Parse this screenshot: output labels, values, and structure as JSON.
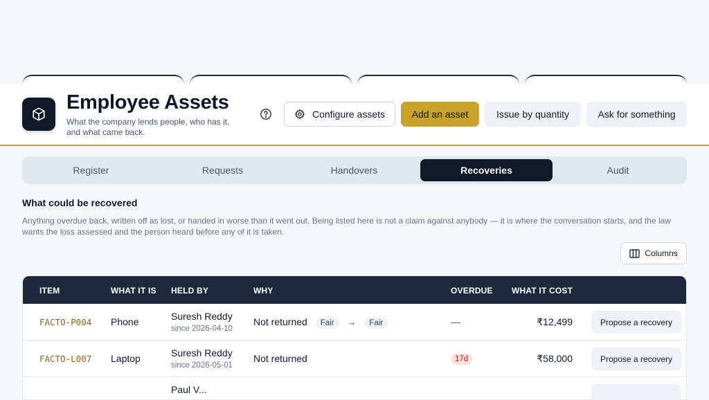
{
  "header": {
    "title": "Employee Assets",
    "subtitle": "What the company lends people, who has it, and what came back.",
    "buttons": {
      "configure": "Configure assets",
      "add": "Add an asset",
      "issue": "Issue by quantity",
      "ask": "Ask for something"
    }
  },
  "tabs": [
    {
      "label": "Register"
    },
    {
      "label": "Requests"
    },
    {
      "label": "Handovers"
    },
    {
      "label": "Recoveries",
      "active": true
    },
    {
      "label": "Audit"
    }
  ],
  "section": {
    "title": "What could be recovered",
    "description": "Anything overdue back, written off as lost, or handed in worse than it went out. Being listed here is not a claim against anybody — it is where the conversation starts, and the law wants the loss assessed and the person heard before any of it is taken."
  },
  "columns_button": "Columns",
  "table": {
    "headers": {
      "item": "ITEM",
      "what": "WHAT IT IS",
      "held": "HELD BY",
      "why": "WHY",
      "overdue": "OVERDUE",
      "cost": "WHAT IT COST"
    },
    "rows": [
      {
        "item": "FACTO-P004",
        "what": "Phone",
        "held_by": "Suresh Reddy",
        "since": "since 2026-04-10",
        "why": "Not returned",
        "condition_from": "Fair",
        "arrow": "→",
        "condition_to": "Fair",
        "overdue": "—",
        "cost": "₹12,499",
        "action": "Propose a recovery"
      },
      {
        "item": "FACTO-L007",
        "what": "Laptop",
        "held_by": "Suresh Reddy",
        "since": "since 2026-05-01",
        "why": "Not returned",
        "overdue": "17d",
        "cost": "₹58,000",
        "action": "Propose a recovery"
      },
      {
        "held_by": "Paul V..."
      }
    ]
  },
  "colors": {
    "accent": "#c9a227",
    "dark": "#111827",
    "table_header": "#1e293b",
    "overdue_bg": "#fde2e2",
    "overdue_text": "#b42318"
  },
  "icons": {
    "logo": "cube-icon",
    "help": "question-circle-icon",
    "configure": "gear-icon",
    "columns": "columns-icon"
  }
}
